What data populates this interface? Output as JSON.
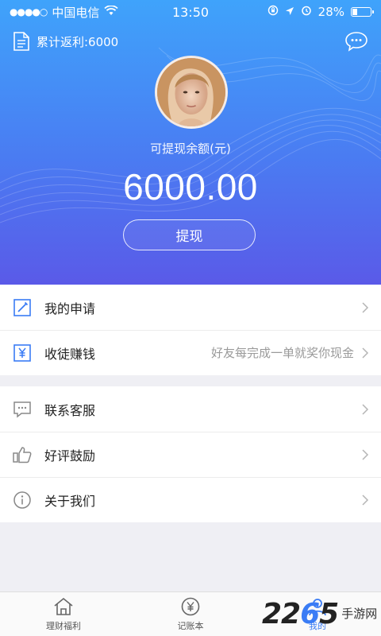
{
  "status_bar": {
    "carrier": "中国电信",
    "time": "13:50",
    "battery": "28%",
    "battery_level": 0.28
  },
  "header": {
    "cumulative_rebate": "累计返利:6000"
  },
  "balance": {
    "label": "可提现余额(元)",
    "amount": "6000.00",
    "withdraw_label": "提现"
  },
  "menu_group_1": [
    {
      "label": "我的申请",
      "desc": "",
      "icon": "edit-icon"
    },
    {
      "label": "收徒赚钱",
      "desc": "好友每完成一单就奖你现金",
      "icon": "yen-icon"
    }
  ],
  "menu_group_2": [
    {
      "label": "联系客服",
      "desc": "",
      "icon": "chat-bubble-icon"
    },
    {
      "label": "好评鼓励",
      "desc": "",
      "icon": "thumbs-up-icon"
    },
    {
      "label": "关于我们",
      "desc": "",
      "icon": "info-icon"
    }
  ],
  "tabbar": {
    "tabs": [
      {
        "label": "理财福利",
        "icon": "home-icon",
        "active": false
      },
      {
        "label": "记账本",
        "icon": "yen-circle-icon",
        "active": false
      },
      {
        "label": "我的",
        "icon": "user-icon",
        "active": true
      }
    ]
  },
  "watermark": {
    "number_prefix": "22",
    "number_mid": "6",
    "number_suffix": "5",
    "text": "手游网"
  },
  "colors": {
    "accent": "#3a7cf5",
    "hero_top": "#3fa3fb",
    "hero_bottom": "#5a5ae8"
  }
}
